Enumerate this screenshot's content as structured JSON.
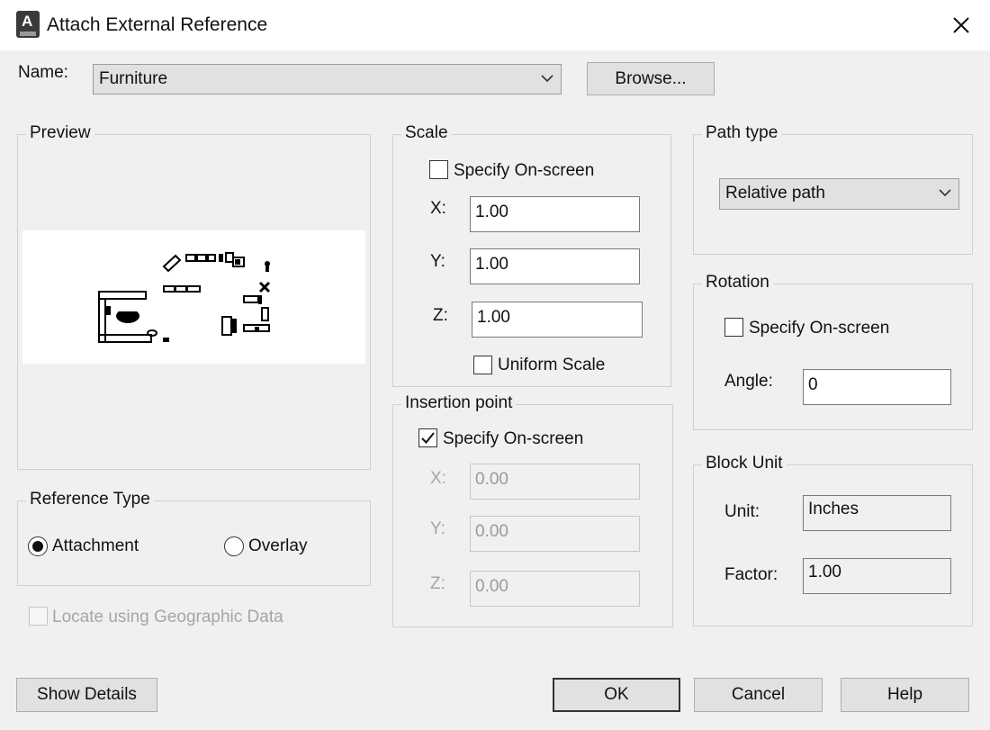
{
  "window": {
    "title": "Attach External Reference",
    "app_icon": "autocad-app-icon",
    "app_icon_letter": "A"
  },
  "name_row": {
    "label": "Name:",
    "value": "Furniture",
    "browse_label": "Browse..."
  },
  "preview": {
    "title": "Preview"
  },
  "scale": {
    "title": "Scale",
    "specify_label": "Specify On-screen",
    "specify_checked": false,
    "x_label": "X:",
    "x_value": "1.00",
    "y_label": "Y:",
    "y_value": "1.00",
    "z_label": "Z:",
    "z_value": "1.00",
    "uniform_label": "Uniform Scale",
    "uniform_checked": false
  },
  "insertion": {
    "title": "Insertion point",
    "specify_label": "Specify On-screen",
    "specify_checked": true,
    "x_label": "X:",
    "x_value": "0.00",
    "y_label": "Y:",
    "y_value": "0.00",
    "z_label": "Z:",
    "z_value": "0.00"
  },
  "path_type": {
    "title": "Path type",
    "value": "Relative path"
  },
  "rotation": {
    "title": "Rotation",
    "specify_label": "Specify On-screen",
    "specify_checked": false,
    "angle_label": "Angle:",
    "angle_value": "0"
  },
  "block_unit": {
    "title": "Block Unit",
    "unit_label": "Unit:",
    "unit_value": "Inches",
    "factor_label": "Factor:",
    "factor_value": "1.00"
  },
  "reference_type": {
    "title": "Reference Type",
    "attachment_label": "Attachment",
    "overlay_label": "Overlay",
    "selected": "Attachment"
  },
  "geo": {
    "label": "Locate using Geographic Data",
    "checked": false,
    "enabled": false
  },
  "buttons": {
    "show_details": "Show Details",
    "ok": "OK",
    "cancel": "Cancel",
    "help": "Help"
  },
  "colors": {
    "dialog_bg": "#f0f0f0",
    "titlebar_bg": "#ffffff",
    "button_bg": "#e1e1e1",
    "disabled_text": "#a5a5a5"
  }
}
